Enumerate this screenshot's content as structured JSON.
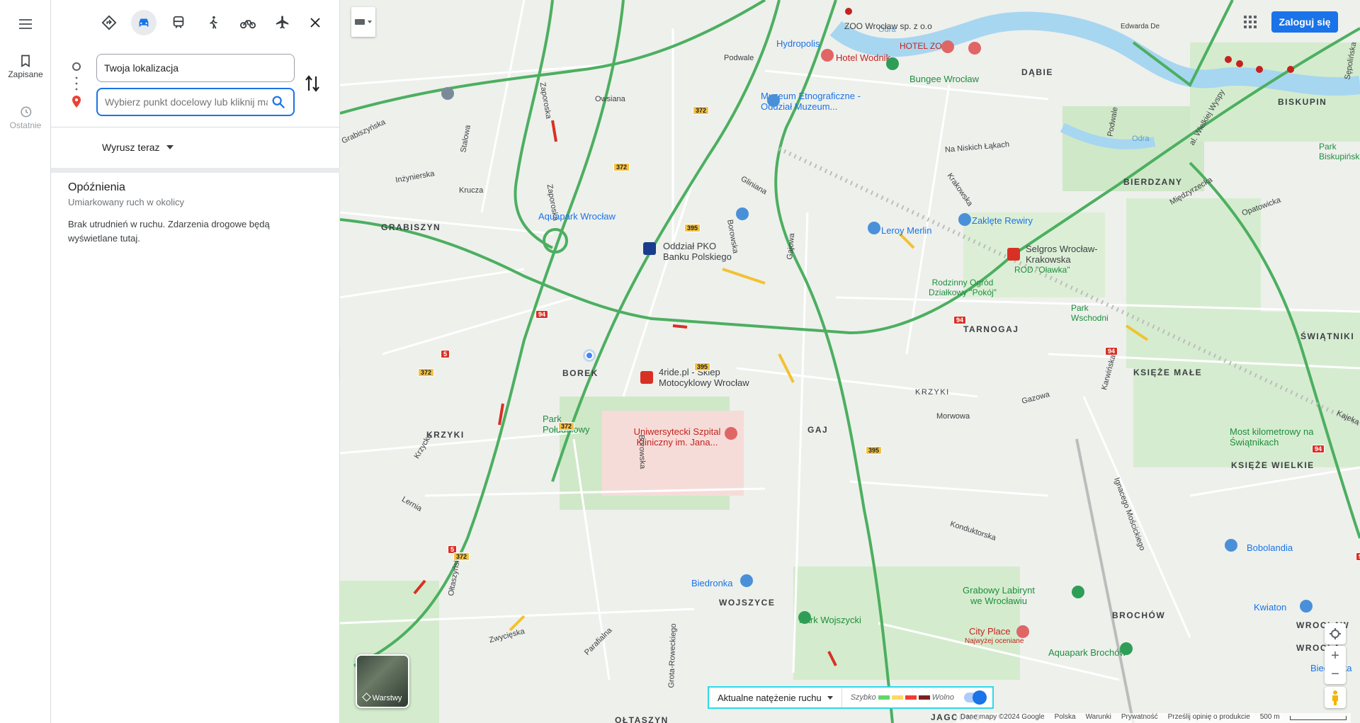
{
  "rail": {
    "saved_label": "Zapisane",
    "recent_label": "Ostatnie"
  },
  "directions": {
    "origin_value": "Twoja lokalizacja",
    "destination_placeholder": "Wybierz punkt docelowy lub kliknij mapę",
    "depart_label": "Wyrusz teraz"
  },
  "delays": {
    "title": "Opóźnienia",
    "subtitle": "Umiarkowany ruch w okolicy",
    "body": "Brak utrudnień w ruchu. Zdarzenia drogowe będą wyświetlane tutaj."
  },
  "map": {
    "login_label": "Zaloguj się",
    "layers_label": "Warstwy",
    "traffic": {
      "label": "Aktualne natężenie ruchu",
      "fast": "Szybko",
      "slow": "Wolno",
      "colors": [
        "#63d668",
        "#ffd966",
        "#f23c32",
        "#811f1f"
      ]
    },
    "attribution": {
      "data": "Dane mapy ©2024 Google",
      "country": "Polska",
      "terms": "Warunki",
      "privacy": "Prywatność",
      "feedback": "Prześlij opinię o produkcie",
      "scale": "500 m"
    },
    "districts": {
      "grabiszyn": "GRABISZYN",
      "borek": "BOREK",
      "krzyki1": "KRZYKI",
      "krzyki2": "KRZYKI",
      "gaj": "GAJ",
      "tarnogaj": "TARNOGAJ",
      "dabie": "DĄBIE",
      "biskupin": "BISKUPIN",
      "bierdzany": "BIERDZANY",
      "swiatniki": "ŚWIĄTNIKI",
      "ksieze_male": "KSIĘŻE MAŁE",
      "ksieze_wielkie": "KSIĘŻE WIELKIE",
      "wojszyce": "WOJSZYCE",
      "brochow": "BROCHÓW",
      "olaszyn": "OŁTASZYN",
      "jagodno": "JAGODNO",
      "wroclaw1": "WROCŁAW",
      "wroclaw2": "WROCŁA"
    },
    "streets": {
      "podwale1": "Podwale",
      "podwale2": "Podwale",
      "owsiana": "Owsiana",
      "grabiszynska": "Grabiszyńska",
      "stalowa": "Stalowa",
      "inzynierska": "Inżynierska",
      "krucza": "Krucza",
      "zaporoska1": "Zaporoska",
      "zaporoska2": "Zaporoska",
      "glinana": "Gliniana",
      "borowska": "Borowska",
      "gajowa": "Gajowa",
      "na_niskich_lakach": "Na Niskich Łąkach",
      "krakowska": "Krakowska",
      "odra1": "Odra",
      "odra2": "Odra",
      "opatowicka": "Opatowicka",
      "miedzyrzecka": "Międzyrzecka",
      "morwowa": "Morwowa",
      "gazowa": "Gazowa",
      "krzycka": "Krzycka",
      "lemia": "Lernia",
      "olszewskiego": "Ołtaszyńska",
      "konduktorska": "Konduktorska",
      "parafialna": "Parafialna",
      "zwyciezka": "Zwycięska",
      "grota": "Grota-Roweckiego",
      "borowska2": "Borowska",
      "mosciekiego": "Ignacego Mościckiego",
      "karwinska": "Karwińska",
      "kajecka": "Kajeka",
      "aleja": "al. Wielkiej Wyspy",
      "szczytnicka": "Sępolińska"
    },
    "pois": {
      "zoo": "ZOO Wrocław sp. z o.o",
      "hotel_zoo": "HOTEL ZOO",
      "hotel_wodnik": "Hotel Wodnik",
      "hydropolis": "Hydropolis",
      "bungee": "Bungee Wrocław",
      "muzeum": "Muzeum Etnograficzne - Oddział Muzeum...",
      "aquapark": "Aquapark Wrocław",
      "pko": "Oddział PKO Banku Polskiego",
      "leroy": "Leroy Merlin",
      "zaklete": "Zaklęte Rewiry",
      "selgros": "Selgros Wrocław-Krakowska",
      "rod": "ROD \"Oławka\"",
      "rodzinny": "Rodzinny Ogród Działkowy \"Pokój\"",
      "park_wschodni": "Park Wschodni",
      "park_biskupinski": "Park Biskupiński",
      "moto": "4ride.pl - Sklep Motocyklowy Wrocław",
      "park_poludniowy": "Park Południowy",
      "szpital": "Uniwersytecki Szpital Kliniczny im. Jana...",
      "most": "Most kilometrowy na Świątnikach",
      "biedronka1": "Biedronka",
      "biedronka2": "Biedronka",
      "labirynt": "Grabowy Labirynt we Wrocławiu",
      "park_wojszycki": "Park Wojszycki",
      "city_place": "City Place",
      "najwyzej": "Najwyżej oceniane",
      "aquapark_brochow": "Aquapark Brochów",
      "bobolandia": "Bobolandia",
      "kwiaton": "Kwiaton",
      "edwarda": "Edwarda De"
    },
    "shields": [
      "372",
      "372",
      "372",
      "372",
      "395",
      "395",
      "395",
      "94",
      "94",
      "94",
      "94",
      "94",
      "5",
      "5",
      "372"
    ]
  }
}
